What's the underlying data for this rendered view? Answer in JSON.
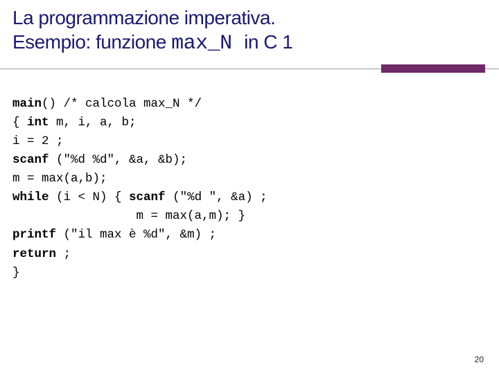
{
  "title": {
    "line1": "La programmazione imperativa.",
    "line2_a": "Esempio: funzione ",
    "line2_mono": "max_N ",
    "line2_b": "in C  1"
  },
  "code": {
    "l1a": "main",
    "l1b": "() /* calcola max_N */",
    "l2a": "{ ",
    "l2b": "int",
    "l2c": " m, i, a, b;",
    "l3": "i = 2 ;",
    "l4a": "scanf",
    "l4b": " (\"%d %d\", &a, &b);",
    "l5": "m = max(a,b);",
    "l6a": "while",
    "l6b": " (i < N) { ",
    "l6c": "scanf",
    "l6d": " (\"%d \", &a) ;",
    "l7": "                 m = max(a,m); }",
    "l8a": "printf",
    "l8b": " (\"il max è %d\", &m) ;",
    "l9a": "return",
    "l9b": " ;",
    "l10": "}"
  },
  "page_number": "20"
}
